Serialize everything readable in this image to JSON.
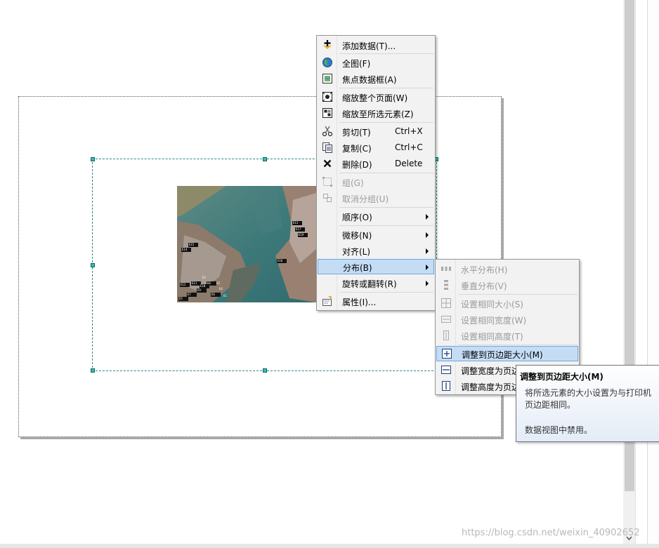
{
  "main_menu": [
    {
      "label": "添加数据(T)...",
      "icon": "add-data-icon",
      "enabled": true
    },
    {
      "separator": true
    },
    {
      "label": "全图(F)",
      "icon": "globe-icon",
      "enabled": true
    },
    {
      "label": "焦点数据框(A)",
      "icon": "focus-frame-icon",
      "enabled": true
    },
    {
      "separator": true
    },
    {
      "label": "缩放整个页面(W)",
      "icon": "zoom-page-icon",
      "enabled": true
    },
    {
      "label": "缩放至所选元素(Z)",
      "icon": "zoom-selected-icon",
      "enabled": true
    },
    {
      "separator": true
    },
    {
      "label": "剪切(T)",
      "shortcut": "Ctrl+X",
      "icon": "scissors-icon",
      "enabled": true
    },
    {
      "label": "复制(C)",
      "shortcut": "Ctrl+C",
      "icon": "copy-icon",
      "enabled": true
    },
    {
      "label": "删除(D)",
      "shortcut": "Delete",
      "icon": "delete-x-icon",
      "enabled": true
    },
    {
      "separator": true
    },
    {
      "label": "组(G)",
      "icon": "group-icon",
      "enabled": false
    },
    {
      "label": "取消分组(U)",
      "icon": "ungroup-icon",
      "enabled": false
    },
    {
      "separator": true
    },
    {
      "label": "顺序(O)",
      "submenu": true,
      "enabled": true
    },
    {
      "separator": true
    },
    {
      "label": "微移(N)",
      "submenu": true,
      "enabled": true
    },
    {
      "label": "对齐(L)",
      "submenu": true,
      "enabled": true
    },
    {
      "label": "分布(B)",
      "submenu": true,
      "enabled": true,
      "highlighted": true
    },
    {
      "label": "旋转或翻转(R)",
      "submenu": true,
      "enabled": true
    },
    {
      "separator": true
    },
    {
      "label": "属性(I)...",
      "icon": "properties-icon",
      "enabled": true
    }
  ],
  "sub_menu": [
    {
      "label": "水平分布(H)",
      "icon": "distribute-horizontal-icon",
      "enabled": false
    },
    {
      "label": "垂直分布(V)",
      "icon": "distribute-vertical-icon",
      "enabled": false
    },
    {
      "separator": true
    },
    {
      "label": "设置相同大小(S)",
      "icon": "same-size-icon",
      "enabled": false
    },
    {
      "label": "设置相同宽度(W)",
      "icon": "same-width-icon",
      "enabled": false
    },
    {
      "label": "设置相同高度(T)",
      "icon": "same-height-icon",
      "enabled": false
    },
    {
      "separator": true
    },
    {
      "label": "调整到页边距大小(M)",
      "icon": "fit-to-margins-icon",
      "enabled": true,
      "highlighted": true
    },
    {
      "label": "调整宽度为页边",
      "icon": "fit-width-icon",
      "enabled": true
    },
    {
      "label": "调整高度为页边",
      "icon": "fit-height-icon",
      "enabled": true
    }
  ],
  "tooltip": {
    "title": "调整到页边距大小(M)",
    "body": "将所选元素的大小设置为与打印机页边距相同。",
    "note": "数据视图中禁用。"
  },
  "map_labels": [
    "E13",
    "E17",
    "E19",
    "E15",
    "E14",
    "E16",
    "E12",
    "E11",
    "E10",
    "E8",
    "E9",
    "E7",
    "E6",
    "E5",
    "E4",
    "E3",
    "E2",
    "E1"
  ],
  "watermark": "https://blog.csdn.net/weixin_40902652",
  "colors": {
    "highlight": "#c4ddf5",
    "highlight_border": "#6fa8dc",
    "selection": "#2b8a8a",
    "handle": "#29c2b8"
  }
}
